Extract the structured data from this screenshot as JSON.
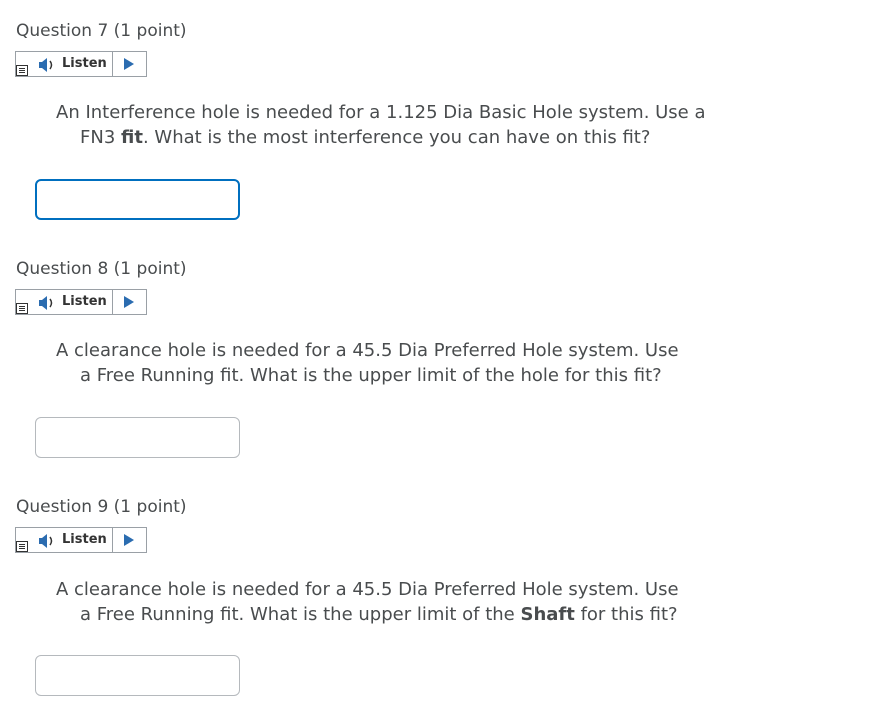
{
  "questions": [
    {
      "label": "Question 7",
      "points": "(1 point)",
      "listen_label": "Listen",
      "text_line1": "An Interference hole is needed for a 1.125 Dia Basic Hole system. Use a",
      "text_line2_pre": "FN3 ",
      "text_line2_bold": "fit",
      "text_line2_post": ". What is the most interference you can have on this fit?",
      "answer_value": ""
    },
    {
      "label": "Question 8",
      "points": "(1 point)",
      "listen_label": "Listen",
      "text_line1": "A clearance hole is needed for a 45.5 Dia Preferred Hole system. Use",
      "text_line2_pre": "a Free Running fit. What is the upper limit of the hole for this fit?",
      "text_line2_bold": "",
      "text_line2_post": "",
      "answer_value": ""
    },
    {
      "label": "Question 9",
      "points": "(1 point)",
      "listen_label": "Listen",
      "text_line1": "A clearance hole is needed for a 45.5 Dia Preferred Hole system. Use",
      "text_line2_pre": "a Free Running fit. What is the upper limit of the ",
      "text_line2_bold": "Shaft",
      "text_line2_post": " for this fit?",
      "answer_value": ""
    }
  ],
  "colors": {
    "text": "#494c4e",
    "focus_border": "#006fbf",
    "input_border": "#b5b9bd",
    "play_icon": "#2b6cb0"
  },
  "icons": {
    "menu": "menu-icon",
    "speaker": "speaker-icon",
    "play": "play-icon"
  }
}
